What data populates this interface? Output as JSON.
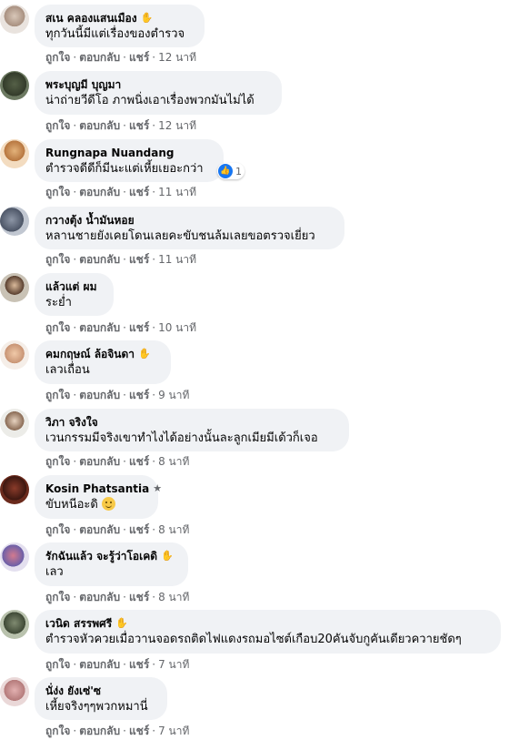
{
  "actions": {
    "like": "ถูกใจ",
    "reply": "ตอบกลับ",
    "share": "แชร์",
    "sep": "·"
  },
  "icons": {
    "wave": "waving-hand-icon",
    "star": "star-icon",
    "like": "like-reaction-icon",
    "smile": "smile-emoji-icon"
  },
  "colors": {
    "bubble": "#f0f2f5",
    "meta": "#65676b",
    "like_blue": "#1877f2"
  },
  "comments": [
    {
      "name": "สเน คลองแสนเมือง",
      "badge": "wave",
      "text": "ทุกวันนี้มีแต่เรื่องของตำรวจ",
      "time": "12 นาที"
    },
    {
      "name": "พระบุญมี บุญมา",
      "badge": "",
      "text": "น่าถ่ายวีดีโอ ภาพนิ่งเอาเรื่องพวกมันไม่ได้",
      "time": "12 นาที"
    },
    {
      "name": "Rungnapa Nuandang",
      "badge": "",
      "text": "ตำรวจดีดีก็มีนะแต่เหี้ยเยอะกว่า",
      "time": "11 นาที",
      "reaction_count": "1"
    },
    {
      "name": "กวางตุ้ง น้ำมันหอย",
      "badge": "",
      "text": "หลานชายยังเคยโดนเลยคะขับชนล้มเลยขอตรวจเยี่ยว",
      "time": "11 นาที"
    },
    {
      "name": "แล้วแต่ ผม",
      "badge": "",
      "text": "ระย่ำ",
      "time": "10 นาที"
    },
    {
      "name": "คมกฤษณ์ ล้อจินดา",
      "badge": "wave",
      "text": "เลวเถื่อน",
      "time": "9 นาที"
    },
    {
      "name": "วิภา จริงใจ",
      "badge": "",
      "text": "เวนกรรมมีจริงเขาทำไงได้อย่างนั้นละลูกเมียมีเด้วก็เจอ",
      "time": "8 นาที"
    },
    {
      "name": "Kosin Phatsantia",
      "badge": "star",
      "text": "ขับหนีอะดิ",
      "time": "8 นาที",
      "emoji": "smile"
    },
    {
      "name": "รักฉันแล้ว จะรู้ว่าโอเคดิ",
      "badge": "wave",
      "text": "เลว",
      "time": "8 นาที"
    },
    {
      "name": "เวนิด สรรพศรี",
      "badge": "wave",
      "text": "ตำรวจหัวควยเมื่อวานจอดรถติดไฟแดงรถมอไซต์เกือบ20คันจับกูคันเดียวควายชัดๆ",
      "time": "7 นาที"
    },
    {
      "name": "นั่ง่ง ยังเซ่'ซ",
      "badge": "",
      "text": "เหี้ยจริงๆๆพวกหมานี่",
      "time": "7 นาที"
    }
  ]
}
